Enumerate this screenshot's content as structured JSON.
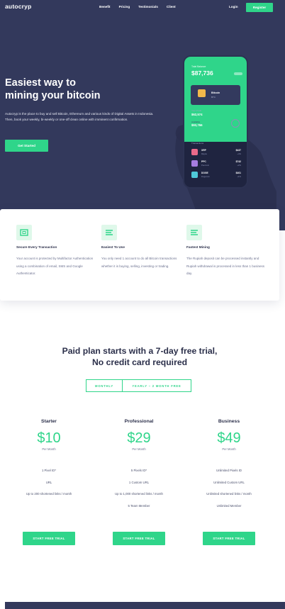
{
  "nav": {
    "logo": "autocryp",
    "links": [
      "Benefit",
      "Pricing",
      "Testimonials",
      "Client"
    ],
    "login": "Login",
    "register": "Register"
  },
  "hero": {
    "title_line1": "Easiest way to",
    "title_line2": "mining your bitcoin",
    "description": "Autocryp is the place to buy and sell Bitcoin, Ethereum and various kinds of Digital Assets in Indonesia. Then, book your weekly, bi-weekly or one-off clean online with imminent confirmation.",
    "cta": "Get Started"
  },
  "phone": {
    "balance_label": "Total Balance",
    "balance": "$87,736",
    "card_title": "Bitcoin",
    "card_sub": "BTC",
    "row1_label": "Your Profit",
    "row1_value": "$62,574",
    "row2_label": "Available",
    "row2_value": "$93,766",
    "list_header": "Transactions",
    "items": [
      {
        "name": "XRP",
        "sub": "Ripple",
        "amount": "$437",
        "amount_sub": "+4%"
      },
      {
        "name": "PPC",
        "sub": "Peercoin",
        "amount": "$742",
        "amount_sub": "+2%"
      },
      {
        "name": "DOGE",
        "sub": "Dogecoin",
        "amount": "$401",
        "amount_sub": "+1%"
      }
    ]
  },
  "features": [
    {
      "title": "Secure Every Transaction",
      "description": "Your account is protected by Multifactor Authentication using a combination of email, SMS and Google Authenticator.",
      "icon": "wallet-icon"
    },
    {
      "title": "Easiest To Use",
      "description": "You only need 1 account to do all Bitcoin transactions whether it is buying, selling, investing or trading.",
      "icon": "lines-icon"
    },
    {
      "title": "Fastest Mining",
      "description": "The Rupiah deposit can be processed instantly and Rupiah withdrawal is processed in less than 1 business day.",
      "icon": "lines-icon"
    }
  ],
  "pricing": {
    "title_line1": "Paid plan starts with a 7-day free trial,",
    "title_line2": "No credit card required",
    "toggle_monthly": "MONTHLY",
    "toggle_yearly": "YEARLY – 2 MONTH FREE",
    "plans": [
      {
        "name": "Starter",
        "price": "$10",
        "per": "Per Month",
        "features": [
          "1 Pixel ID*",
          "URL",
          "Up to 200 shortened links / month"
        ],
        "cta": "START FREE TRIAL"
      },
      {
        "name": "Professional",
        "price": "$29",
        "per": "Per Month",
        "features": [
          "5 Pixels ID*",
          "1 Custom URL",
          "Up to 1,000 shortened links / month",
          "5 Team Member"
        ],
        "cta": "START FREE TRIAL"
      },
      {
        "name": "Business",
        "price": "$49",
        "per": "Per Month",
        "features": [
          "Unlimited Pixels ID",
          "Unlimited Custom URL",
          "Unlimited shortened links / month",
          "Unlimited Member"
        ],
        "cta": "START FREE TRIAL"
      }
    ]
  },
  "colors": {
    "accent": "#2fd58a",
    "navy": "#33395c",
    "text": "#2b2f4a"
  }
}
